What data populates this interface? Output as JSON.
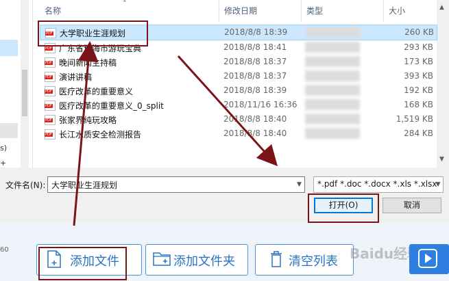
{
  "columns": {
    "name": "名称",
    "date": "修改日期",
    "type": "类型",
    "size": "大小"
  },
  "left_pane": {
    "frag1": "s)",
    "frag2": "+"
  },
  "files": [
    {
      "name": "大学职业生涯规划",
      "date": "2018/8/8 18:39",
      "size": "260 KB",
      "selected": true
    },
    {
      "name": "广东省珠海市游玩宝典",
      "date": "2018/8/8 18:41",
      "size": "293 KB",
      "selected": false
    },
    {
      "name": "晚间新闻主持稿",
      "date": "2018/8/8 18:37",
      "size": "173 KB",
      "selected": false
    },
    {
      "name": "演讲讲稿",
      "date": "2018/8/8 18:37",
      "size": "393 KB",
      "selected": false
    },
    {
      "name": "医疗改革的重要意义",
      "date": "2018/8/8 18:39",
      "size": "192 KB",
      "selected": false
    },
    {
      "name": "医疗改革的重要意义_0_split",
      "date": "2018/11/16 16:36",
      "size": "168 KB",
      "selected": false
    },
    {
      "name": "张家界纯玩攻略",
      "date": "2018/8/8 18:40",
      "size": "1,519 KB",
      "selected": false
    },
    {
      "name": "长江水质安全检测报告",
      "date": "2018/8/8 18:40",
      "size": "284 KB",
      "selected": false
    }
  ],
  "filename": {
    "label": "文件名(N):",
    "value": "大学职业生涯规划"
  },
  "filter": {
    "value": "*.pdf *.doc *.docx *.xls *.xlsx"
  },
  "buttons": {
    "open": "打开(O)",
    "cancel": "取消"
  },
  "app": {
    "add_file": "添加文件",
    "add_folder": "添加文件夹",
    "clear_list": "清空列表",
    "left_text": "60",
    "watermark": "Baidu经验"
  },
  "colors": {
    "selection": "#cce8ff",
    "annotation": "#7b1419",
    "accent": "#0078d7",
    "app_blue": "#2b73c2"
  }
}
